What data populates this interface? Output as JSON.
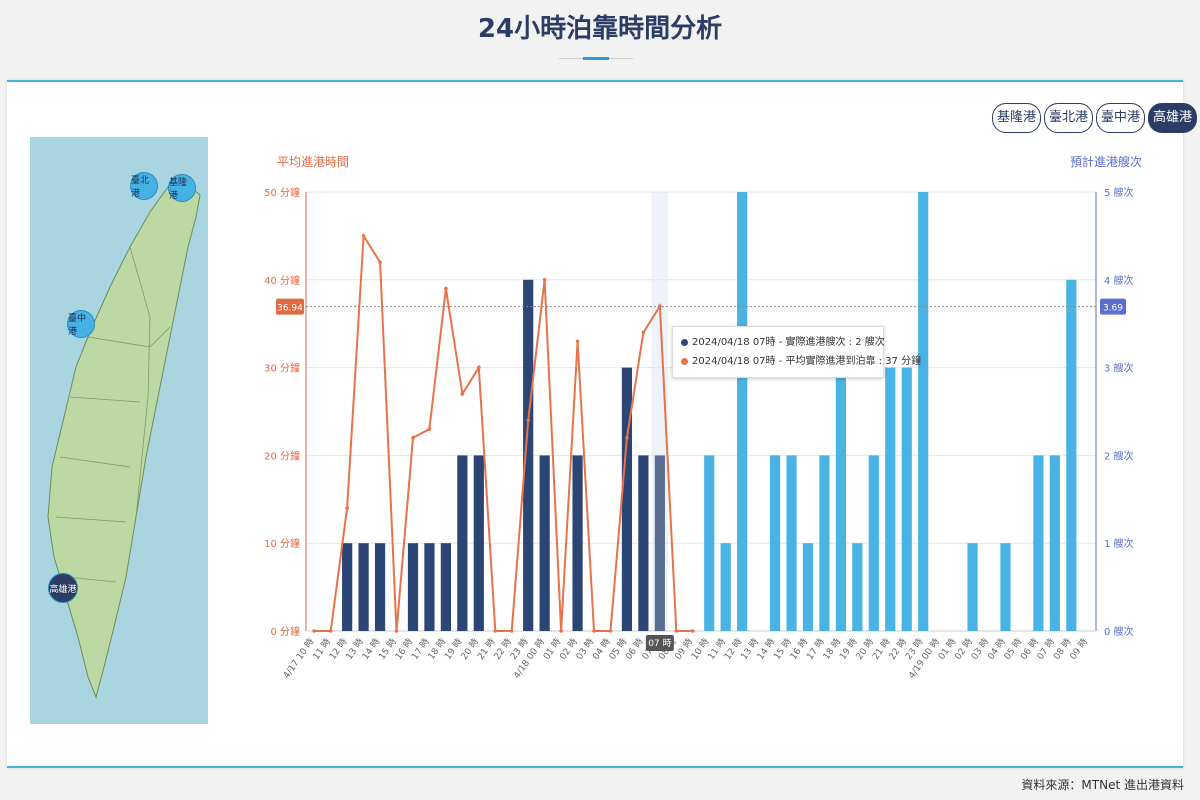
{
  "page": {
    "title": "24小時泊靠時間分析",
    "source": "資料來源：MTNet 進出港資料"
  },
  "port_tabs": [
    {
      "label": "基隆港",
      "active": false
    },
    {
      "label": "臺北港",
      "active": false
    },
    {
      "label": "臺中港",
      "active": false
    },
    {
      "label": "高雄港",
      "active": true
    }
  ],
  "map": {
    "ports": [
      {
        "label": "臺北港",
        "active": false
      },
      {
        "label": "基隆港",
        "active": false
      },
      {
        "label": "臺中港",
        "active": false
      },
      {
        "label": "高雄港",
        "active": true
      }
    ]
  },
  "colors": {
    "actual_bar": "#2b4574",
    "forecast_bar": "#4ab3e6",
    "line": "#e8734a",
    "left_axis": "#e06a42",
    "right_axis": "#5a6fcf",
    "hover_bar": "#5a6e94"
  },
  "tooltip": {
    "row1": "2024/04/18 07時 - 實際進港艘次 : 2 艘次",
    "row2": "2024/04/18 07時 - 平均實際進港到泊靠 : 37 分鐘"
  },
  "chart_data": {
    "type": "bar",
    "left_axis_title": "平均進港時間",
    "right_axis_title": "預計進港艘次",
    "left_ticks": [
      "0 分鐘",
      "10 分鐘",
      "20 分鐘",
      "30 分鐘",
      "40 分鐘",
      "50 分鐘"
    ],
    "right_ticks": [
      "0 艘次",
      "1 艘次",
      "2 艘次",
      "3 艘次",
      "4 艘次",
      "5 艘次"
    ],
    "ylim_left": [
      0,
      50
    ],
    "ylim_right": [
      0,
      5
    ],
    "crosshair_left_label": "36.94",
    "crosshair_right_label": "3.69",
    "hover_label": "07 時",
    "hover_index": 21,
    "categories": [
      "4/17 10 時",
      "11 時",
      "12 時",
      "13 時",
      "14 時",
      "15 時",
      "16 時",
      "17 時",
      "18 時",
      "19 時",
      "20 時",
      "21 時",
      "22 時",
      "23 時",
      "4/18 00 時",
      "01 時",
      "02 時",
      "03 時",
      "04 時",
      "05 時",
      "06 時",
      "07 時",
      "08 時",
      "09 時",
      "10 時",
      "11 時",
      "12 時",
      "13 時",
      "14 時",
      "15 時",
      "16 時",
      "17 時",
      "18 時",
      "19 時",
      "20 時",
      "21 時",
      "22 時",
      "23 時",
      "4/19 00 時",
      "01 時",
      "02 時",
      "03 時",
      "04 時",
      "05 時",
      "06 時",
      "07 時",
      "08 時",
      "09 時"
    ],
    "actual_count": [
      0,
      0,
      1,
      1,
      1,
      0,
      1,
      1,
      1,
      2,
      2,
      0,
      0,
      4,
      2,
      0,
      2,
      0,
      0,
      3,
      2,
      2,
      0,
      0,
      null,
      null,
      null,
      null,
      null,
      null,
      null,
      null,
      null,
      null,
      null,
      null,
      null,
      null,
      null,
      null,
      null,
      null,
      null,
      null,
      null,
      null,
      null,
      null
    ],
    "forecast_count": [
      null,
      null,
      null,
      null,
      null,
      null,
      null,
      null,
      null,
      null,
      null,
      null,
      null,
      null,
      null,
      null,
      null,
      null,
      null,
      null,
      null,
      null,
      null,
      null,
      2,
      1,
      5,
      0,
      2,
      2,
      1,
      2,
      3,
      1,
      2,
      3,
      3,
      5,
      0,
      0,
      1,
      0,
      1,
      0,
      2,
      2,
      4,
      0
    ],
    "avg_minutes": [
      0,
      0,
      14,
      45,
      42,
      0,
      22,
      23,
      39,
      27,
      30,
      0,
      0,
      24,
      40,
      0,
      33,
      0,
      0,
      22,
      34,
      37,
      0,
      0
    ]
  }
}
